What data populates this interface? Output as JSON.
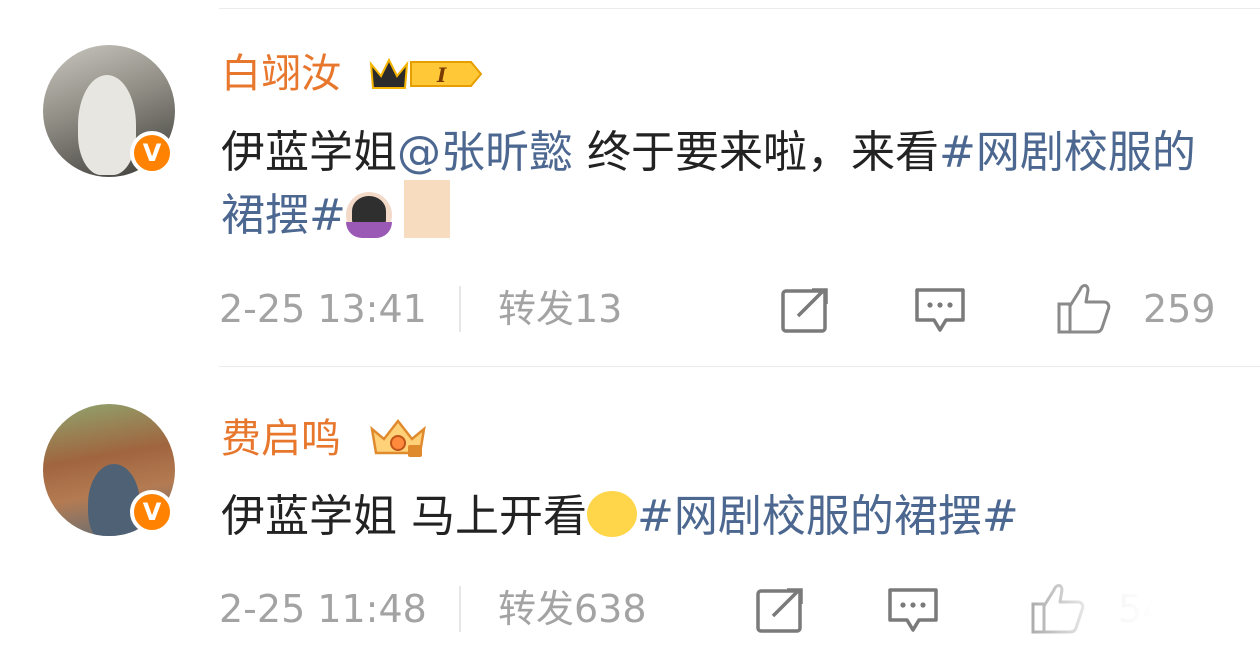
{
  "comments": [
    {
      "username": "白翊汝",
      "badge_text": "I",
      "text_prefix": "伊蓝学姐",
      "mention": "@张昕懿",
      "text_middle": " 终于要来啦，来看",
      "hashtag": "#网剧校服的裙摆#",
      "time": "2-25 13:41",
      "repost": "转发13",
      "likes": "259"
    },
    {
      "username": "费启鸣",
      "text_prefix": "伊蓝学姐 马上开看",
      "hashtag": "#网剧校服的裙摆#",
      "time": "2-25 11:48",
      "repost": "转发638",
      "likes": "5442"
    }
  ],
  "icons": {
    "share": "share-icon",
    "comment": "comment-icon",
    "like": "thumbs-up-icon",
    "verified": "verified-v-icon",
    "crown": "crown-icon"
  },
  "colors": {
    "username": "#e8772e",
    "link": "#4c6790",
    "meta": "#a3a3a3",
    "verified": "#ff8200"
  }
}
